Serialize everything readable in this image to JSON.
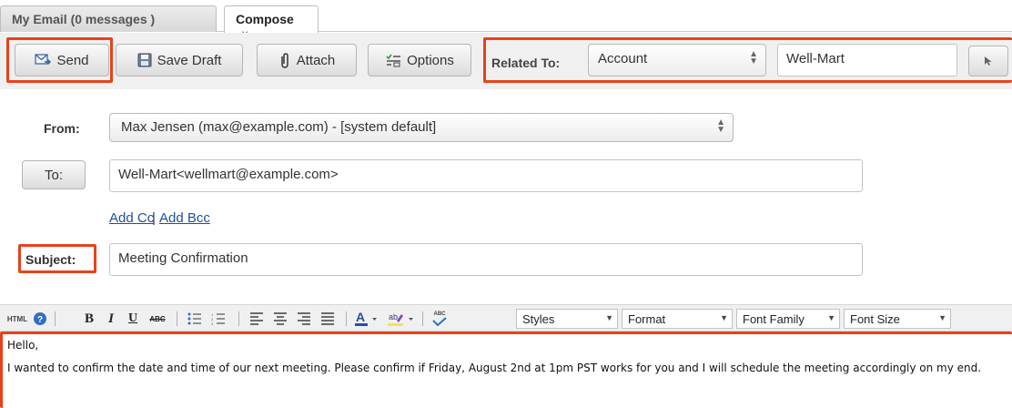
{
  "tabs": [
    {
      "label": "My Email (0 messages )"
    },
    {
      "label": "Compose",
      "close": "×"
    }
  ],
  "toolbar": {
    "send_label": "Send",
    "save_draft_label": "Save Draft",
    "attach_label": "Attach",
    "options_label": "Options",
    "related_to_label": "Related To:",
    "related_module": "Account",
    "related_record": "Well-Mart"
  },
  "form": {
    "from_label": "From:",
    "from_value": "Max Jensen (max@example.com) - [system default]",
    "to_button": "To:",
    "to_value": "Well-Mart<wellmart@example.com>",
    "add_cc": "Add Cc",
    "separator": "|",
    "add_bcc": "Add Bcc",
    "subject_label": "Subject:",
    "subject_value": "Meeting Confirmation"
  },
  "editor": {
    "html_label": "HTML",
    "bold": "B",
    "italic": "I",
    "underline": "U",
    "strike": "ABC",
    "spell": "ABC",
    "styles": "Styles",
    "format": "Format",
    "font_family": "Font Family",
    "font_size": "Font Size",
    "body_greeting": "Hello,",
    "body_text": "I wanted to confirm the date and time of our next meeting. Please confirm if Friday, August 2nd at 1pm PST works for you and I will schedule the meeting accordingly on my end."
  },
  "colors": {
    "highlight": "#e8421a",
    "link": "#1c4f9c"
  }
}
